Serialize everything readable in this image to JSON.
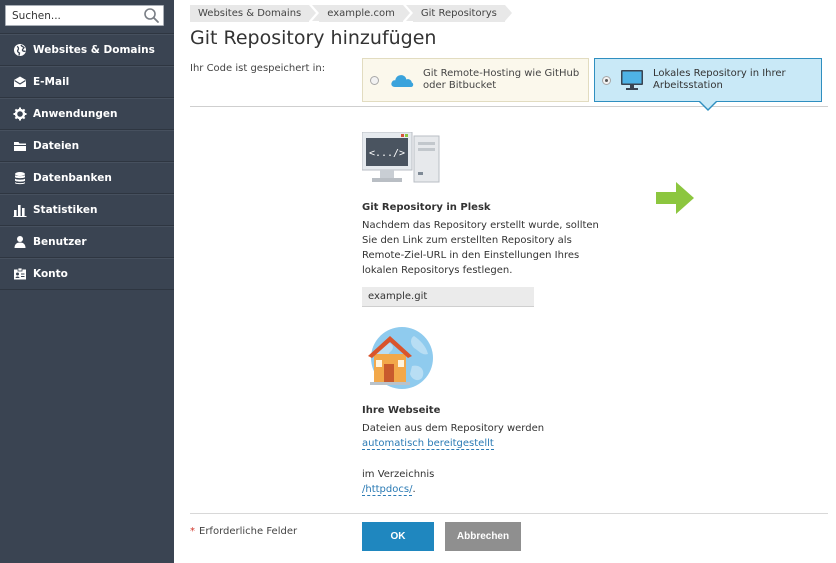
{
  "search": {
    "placeholder": "Suchen..."
  },
  "sidebar": {
    "items": [
      {
        "label": "Websites & Domains",
        "icon": "globe-icon"
      },
      {
        "label": "E-Mail",
        "icon": "envelope-icon"
      },
      {
        "label": "Anwendungen",
        "icon": "gear-icon"
      },
      {
        "label": "Dateien",
        "icon": "folder-icon"
      },
      {
        "label": "Datenbanken",
        "icon": "database-icon"
      },
      {
        "label": "Statistiken",
        "icon": "bar-chart-icon"
      },
      {
        "label": "Benutzer",
        "icon": "user-icon"
      },
      {
        "label": "Konto",
        "icon": "id-card-icon"
      }
    ]
  },
  "breadcrumbs": [
    "Websites & Domains",
    "example.com",
    "Git Repositorys"
  ],
  "page_title": "Git Repository hinzufügen",
  "code_location": {
    "label": "Ihr Code ist gespeichert in:",
    "remote_option": "Git Remote-Hosting wie GitHub oder Bitbucket",
    "local_option": "Lokales Repository in Ihrer Arbeitsstation",
    "selected": "local"
  },
  "plesk_repo": {
    "heading": "Git Repository in Plesk",
    "description": "Nachdem das Repository erstellt wurde, sollten Sie den Link zum erstellten Repository als Remote-Ziel-URL in den Einstellungen Ihres lokalen Repositorys festlegen.",
    "repo_name": "example.git",
    "code_label": "<.../>"
  },
  "website": {
    "heading": "Ihre Webseite",
    "text_before": "Dateien aus dem Repository werden",
    "deploy_link": "automatisch bereitgestellt",
    "dir_label": "im Verzeichnis",
    "dir_link": "/httpdocs/",
    "dir_suffix": "."
  },
  "footer": {
    "required_star": "*",
    "required_label": "Erforderliche Felder",
    "ok_label": "OK",
    "cancel_label": "Abbrechen"
  },
  "colors": {
    "sidebar_bg": "#3a4452",
    "accent_blue": "#1f87bf",
    "selected_option_bg": "#c9e9f7",
    "arrow_green": "#8cc63f",
    "required_red": "#d0362b"
  }
}
